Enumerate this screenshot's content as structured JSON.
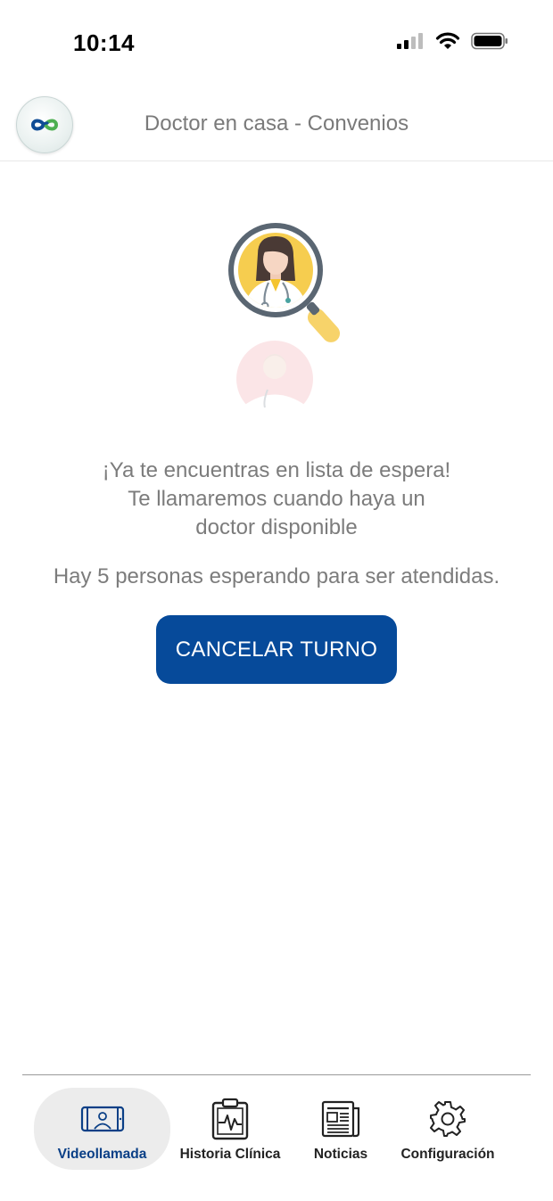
{
  "status_bar": {
    "time": "10:14"
  },
  "header": {
    "title": "Doctor en casa - Convenios",
    "logo_icon": "app-logo-icon"
  },
  "message": {
    "line1": "¡Ya te encuentras en lista de espera!",
    "line2": "Te llamaremos cuando haya un",
    "line3": "doctor disponible"
  },
  "queue_text": "Hay 5 personas esperando para ser atendidas.",
  "cancel_button_label": "CANCELAR TURNO",
  "colors": {
    "primary": "#064a9a",
    "text_muted": "#7c7c7c",
    "active_nav": "#0a3f86"
  },
  "nav": {
    "items": [
      {
        "label": "Videollamada",
        "icon": "video-call-doctor-icon",
        "active": true
      },
      {
        "label": "Historia Clínica",
        "icon": "clipboard-ecg-icon",
        "active": false
      },
      {
        "label": "Noticias",
        "icon": "newspaper-icon",
        "active": false
      },
      {
        "label": "Configuración",
        "icon": "gear-icon",
        "active": false
      }
    ]
  }
}
